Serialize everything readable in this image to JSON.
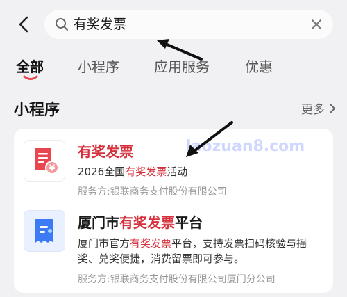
{
  "header": {
    "back_icon": "chevron-left-icon",
    "search_icon": "search-icon",
    "search_query": "有奖发票",
    "clear_icon": "close-icon"
  },
  "tabs": [
    {
      "label": "全部",
      "active": true
    },
    {
      "label": "小程序",
      "active": false
    },
    {
      "label": "应用服务",
      "active": false
    },
    {
      "label": "优惠",
      "active": false
    }
  ],
  "section": {
    "title": "小程序",
    "more_label": "更多",
    "more_icon": "chevron-right-icon"
  },
  "results": [
    {
      "name_parts": [
        "有奖发票"
      ],
      "desc_pre": "2026全国",
      "desc_hl": "有奖发票",
      "desc_post": "活动",
      "provider": "服务方:银联商务支付股份有限公司",
      "icon": "receipt-yen-icon"
    },
    {
      "name_pre": "厦门市",
      "name_hl": "有奖发票",
      "name_post": "平台",
      "desc_pre": "厦门市官方",
      "desc_hl": "有奖发票",
      "desc_post": "平台，支持发票扫码核验与摇奖、兑奖便捷，消费留票即可参与。",
      "provider": "服务方:银联商务支付股份有限公司厦门分公司",
      "icon": "invoice-ticket-icon"
    }
  ],
  "watermark": "laozuan8.com",
  "colors": {
    "highlight": "#d6303c",
    "accent_red": "#e8474f",
    "accent_blue": "#3d7bf5",
    "background": "#f1f1f3"
  }
}
